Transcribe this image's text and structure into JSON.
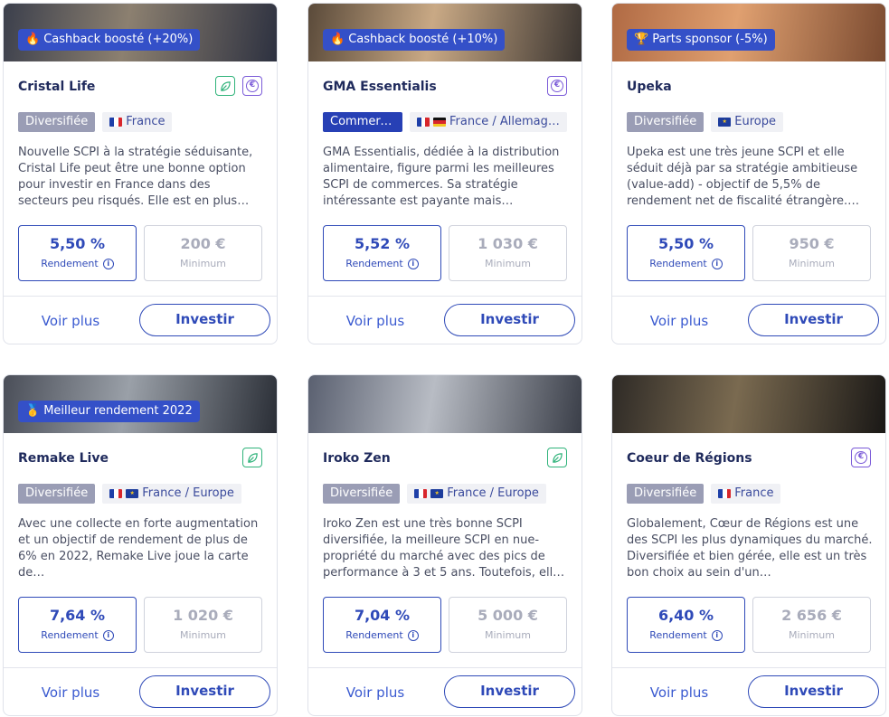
{
  "cards": [
    {
      "badge": "Cashback boosté (+20%)",
      "badge_icon": "fire-icon",
      "badge_emoji": "🔥",
      "title": "Cristal Life",
      "icons": [
        "leaf",
        "euro"
      ],
      "type": "Diversifiée",
      "type_style": "grey",
      "geo": "France",
      "flags": [
        "fr"
      ],
      "description": "Nouvelle SCPI à la stratégie séduisante, Cristal Life peut être une bonne option pour investir en France dans des secteurs peu risqués. Elle est en plus…",
      "yield": "5,50 %",
      "yield_label": "Rendement",
      "minimum": "200 €",
      "minimum_label": "Minimum",
      "more_label": "Voir plus",
      "invest_label": "Investir",
      "photo_colors": [
        "#3b3f4c",
        "#8c8070",
        "#2d3140"
      ]
    },
    {
      "badge": "Cashback boosté (+10%)",
      "badge_icon": "fire-icon",
      "badge_emoji": "🔥",
      "title": "GMA Essentialis",
      "icons": [
        "euro"
      ],
      "type": "Commerces",
      "type_style": "dark",
      "geo": "France / Allemagne",
      "flags": [
        "fr",
        "de"
      ],
      "description": "GMA Essentialis, dédiée à la distribution alimentaire, figure parmi les meilleures SCPI de commerces. Sa stratégie intéressante est payante mais…",
      "yield": "5,52 %",
      "yield_label": "Rendement",
      "minimum": "1 030 €",
      "minimum_label": "Minimum",
      "more_label": "Voir plus",
      "invest_label": "Investir",
      "photo_colors": [
        "#5a4a3a",
        "#c9a985",
        "#3a3430"
      ]
    },
    {
      "badge": "Parts sponsor (-5%)",
      "badge_icon": "trophy-icon",
      "badge_emoji": "🏆",
      "title": "Upeka",
      "icons": [],
      "type": "Diversifiée",
      "type_style": "grey",
      "geo": "Europe",
      "flags": [
        "eu"
      ],
      "description": "Upeka est une très jeune SCPI et elle séduit déjà par sa stratégie ambitieuse (value-add) - objectif de 5,5% de rendement net de fiscalité étrangère.…",
      "yield": "5,50 %",
      "yield_label": "Rendement",
      "minimum": "950 €",
      "minimum_label": "Minimum",
      "more_label": "Voir plus",
      "invest_label": "Investir",
      "photo_colors": [
        "#b06a44",
        "#e0a070",
        "#7a4a30"
      ]
    },
    {
      "badge": "Meilleur rendement 2022",
      "badge_icon": "medal-icon",
      "badge_emoji": "🥇",
      "title": "Remake Live",
      "icons": [
        "leaf"
      ],
      "type": "Diversifiée",
      "type_style": "grey",
      "geo": "France / Europe",
      "flags": [
        "fr",
        "eu"
      ],
      "description": "Avec une collecte en forte augmentation et un objectif de rendement de plus de 6% en 2022, Remake Live joue la carte de…",
      "yield": "7,64 %",
      "yield_label": "Rendement",
      "minimum": "1 020 €",
      "minimum_label": "Minimum",
      "more_label": "Voir plus",
      "invest_label": "Investir",
      "photo_colors": [
        "#4a4e58",
        "#9aa0a8",
        "#2a2e36"
      ]
    },
    {
      "badge": "",
      "badge_icon": "",
      "badge_emoji": "",
      "title": "Iroko Zen",
      "icons": [
        "leaf"
      ],
      "type": "Diversifiée",
      "type_style": "grey",
      "geo": "France / Europe",
      "flags": [
        "fr",
        "eu"
      ],
      "description": "Iroko Zen est une très bonne SCPI diversifiée, la meilleure SCPI en nue-propriété du marché avec des pics de performance à 3 et 5 ans. Toutefois, ell…",
      "yield": "7,04 %",
      "yield_label": "Rendement",
      "minimum": "5 000 €",
      "minimum_label": "Minimum",
      "more_label": "Voir plus",
      "invest_label": "Investir",
      "photo_colors": [
        "#5a6070",
        "#b8bcc4",
        "#3a3e48"
      ]
    },
    {
      "badge": "",
      "badge_icon": "",
      "badge_emoji": "",
      "title": "Coeur de Régions",
      "icons": [
        "euro"
      ],
      "type": "Diversifiée",
      "type_style": "grey",
      "geo": "France",
      "flags": [
        "fr"
      ],
      "description": "Globalement, Cœur de Régions est une des SCPI les plus dynamiques du marché. Diversifiée et bien gérée, elle est un très bon choix au sein d'un…",
      "yield": "6,40 %",
      "yield_label": "Rendement",
      "minimum": "2 656 €",
      "minimum_label": "Minimum",
      "more_label": "Voir plus",
      "invest_label": "Investir",
      "photo_colors": [
        "#2e2a26",
        "#7a6a50",
        "#1a1816"
      ]
    }
  ]
}
